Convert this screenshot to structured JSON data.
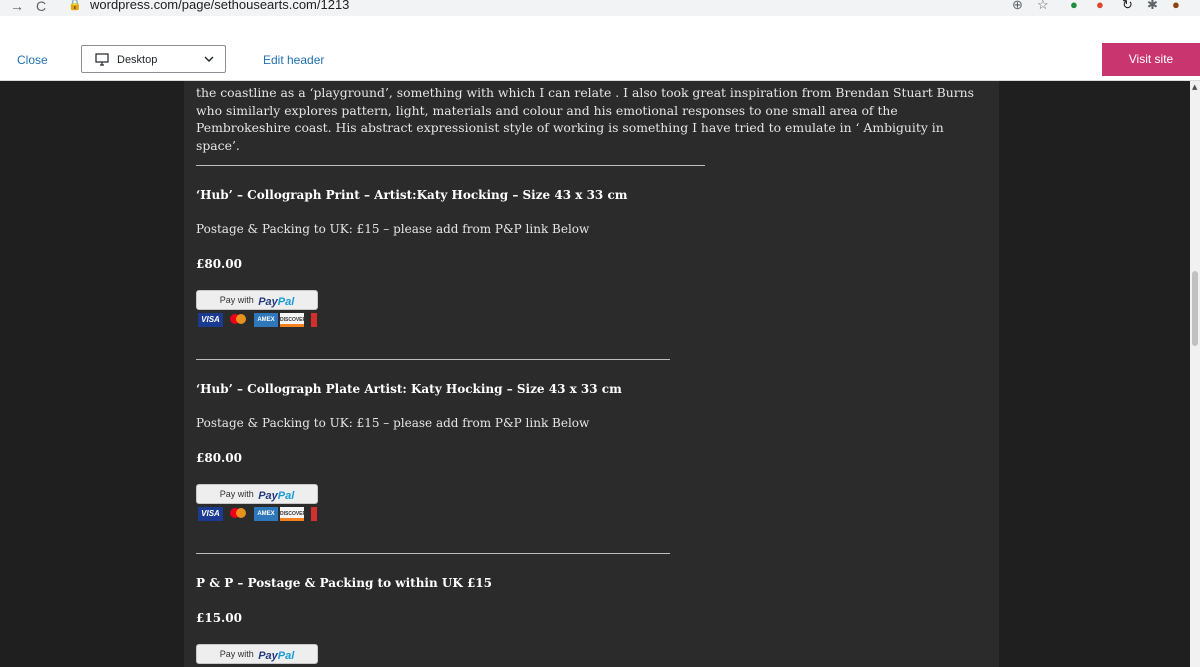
{
  "browser": {
    "url": "wordpress.com/page/sethousearts.com/1213",
    "back_icon": "back-arrow-icon",
    "reload_icon": "reload-icon"
  },
  "toolbar": {
    "close_label": "Close",
    "device_label": "Desktop",
    "edit_header_label": "Edit header",
    "visit_site_label": "Visit site",
    "accent_color": "#c9356e"
  },
  "article": {
    "paragraph": "the coastline as a ‘playground’, something with which I can relate . I also took great inspiration from Brendan Stuart Burns who similarly explores pattern, light, materials and colour and his emotional responses to one small area of the Pembrokeshire coast.  His abstract expressionist style of working is something I have tried to emulate in ‘ Ambiguity in space’."
  },
  "products": [
    {
      "title": "‘Hub’ – Collograph Print – Artist:Katy Hocking – Size 43 x 33 cm",
      "postage": "Postage & Packing to UK: £15 – please add from P&P link Below",
      "price": "£80.00"
    },
    {
      "title": "‘Hub’ – Collograph Plate Artist: Katy Hocking – Size 43 x 33 cm",
      "postage": "Postage & Packing to UK: £15 – please add from P&P link Below",
      "price": "£80.00"
    },
    {
      "title": "P & P – Postage & Packing to within UK £15",
      "price": "£15.00"
    }
  ],
  "paypal": {
    "pay_with": "Pay with",
    "brand_a": "Pay",
    "brand_b": "Pal",
    "visa": "VISA",
    "amex": "AMEX",
    "discover": "DISCOVER"
  }
}
